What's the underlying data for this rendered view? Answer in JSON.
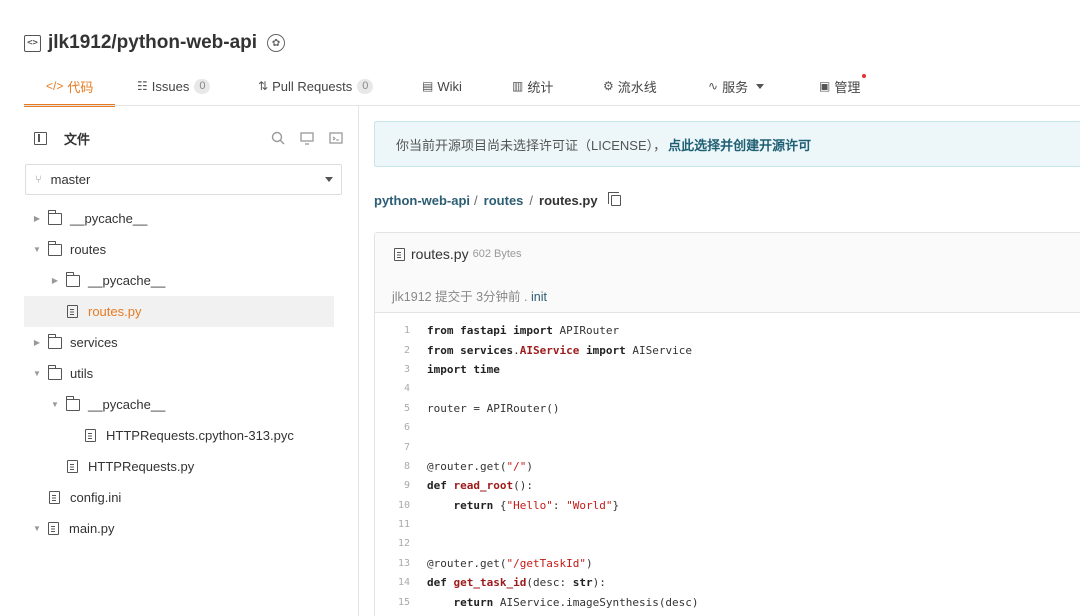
{
  "repo": {
    "name": "jlk1912/python-web-api"
  },
  "tabs": [
    {
      "label": "代码",
      "icon": "code-icon",
      "active": true
    },
    {
      "label": "Issues",
      "icon": "issues-icon",
      "count": "0"
    },
    {
      "label": "Pull Requests",
      "icon": "pull-request-icon",
      "count": "0"
    },
    {
      "label": "Wiki",
      "icon": "wiki-icon"
    },
    {
      "label": "统计",
      "icon": "stats-icon"
    },
    {
      "label": "流水线",
      "icon": "pipeline-icon"
    },
    {
      "label": "服务",
      "icon": "service-icon"
    },
    {
      "label": "管理",
      "icon": "manage-icon"
    }
  ],
  "sidebar": {
    "title": "文件",
    "branch": "master",
    "tree": [
      {
        "label": "__pycache__",
        "type": "folder",
        "depth": 0,
        "expanded": false
      },
      {
        "label": "routes",
        "type": "folder",
        "depth": 0,
        "expanded": true
      },
      {
        "label": "__pycache__",
        "type": "folder",
        "depth": 1,
        "expanded": false
      },
      {
        "label": "routes.py",
        "type": "file",
        "depth": 1,
        "selected": true
      },
      {
        "label": "services",
        "type": "folder",
        "depth": 0,
        "expanded": false
      },
      {
        "label": "utils",
        "type": "folder",
        "depth": 0,
        "expanded": true
      },
      {
        "label": "__pycache__",
        "type": "folder",
        "depth": 1,
        "expanded": true
      },
      {
        "label": "HTTPRequests.cpython-313.pyc",
        "type": "file",
        "depth": 2
      },
      {
        "label": "HTTPRequests.py",
        "type": "file",
        "depth": 1
      },
      {
        "label": "config.ini",
        "type": "file",
        "depth": 0
      },
      {
        "label": "main.py",
        "type": "file",
        "depth": 0,
        "arrow": true
      }
    ]
  },
  "notice": {
    "text": "你当前开源项目尚未选择许可证（LICENSE），",
    "link": "点此选择并创建开源许可"
  },
  "breadcrumb": {
    "root": "python-web-api",
    "folder": "routes",
    "file": "routes.py",
    "sep": "/"
  },
  "file": {
    "name": "routes.py",
    "size": "602 Bytes",
    "commit_author": "jlk1912",
    "commit_time": "提交于 3分钟前 .",
    "commit_msg": "init"
  },
  "code_lines": [
    "1",
    "2",
    "3",
    "4",
    "5",
    "6",
    "7",
    "8",
    "9",
    "10",
    "11",
    "12",
    "13",
    "14",
    "15"
  ]
}
